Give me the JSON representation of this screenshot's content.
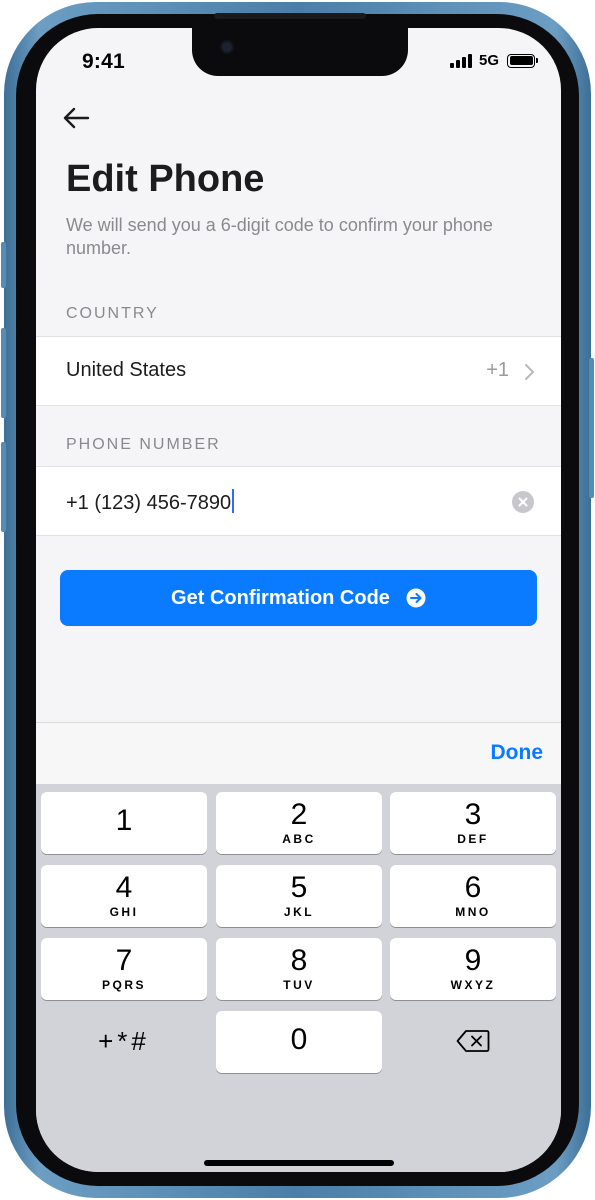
{
  "status_bar": {
    "time": "9:41",
    "network": "5G"
  },
  "header": {
    "title": "Edit Phone",
    "subtitle": "We will send you a 6-digit code to confirm your phone number."
  },
  "country": {
    "section_label": "COUNTRY",
    "name": "United States",
    "dial_code": "+1"
  },
  "phone": {
    "section_label": "PHONE NUMBER",
    "value": "+1 (123) 456-7890"
  },
  "cta": {
    "label": "Get Confirmation Code"
  },
  "keyboard": {
    "toolbar_done": "Done",
    "keys": [
      {
        "num": "1",
        "letters": ""
      },
      {
        "num": "2",
        "letters": "ABC"
      },
      {
        "num": "3",
        "letters": "DEF"
      },
      {
        "num": "4",
        "letters": "GHI"
      },
      {
        "num": "5",
        "letters": "JKL"
      },
      {
        "num": "6",
        "letters": "MNO"
      },
      {
        "num": "7",
        "letters": "PQRS"
      },
      {
        "num": "8",
        "letters": "TUV"
      },
      {
        "num": "9",
        "letters": "WXYZ"
      },
      {
        "num": "0",
        "letters": ""
      }
    ],
    "symbols_label": "+*#"
  },
  "icons": {
    "back": "arrow-left-icon",
    "chevron": "chevron-right-icon",
    "clear": "clear-circle-icon",
    "cta": "arrow-right-circle-icon",
    "delete": "backspace-icon"
  },
  "colors": {
    "accent": "#0a7aff",
    "cursor": "#2e6bff",
    "frame": "#4b7ea8"
  }
}
